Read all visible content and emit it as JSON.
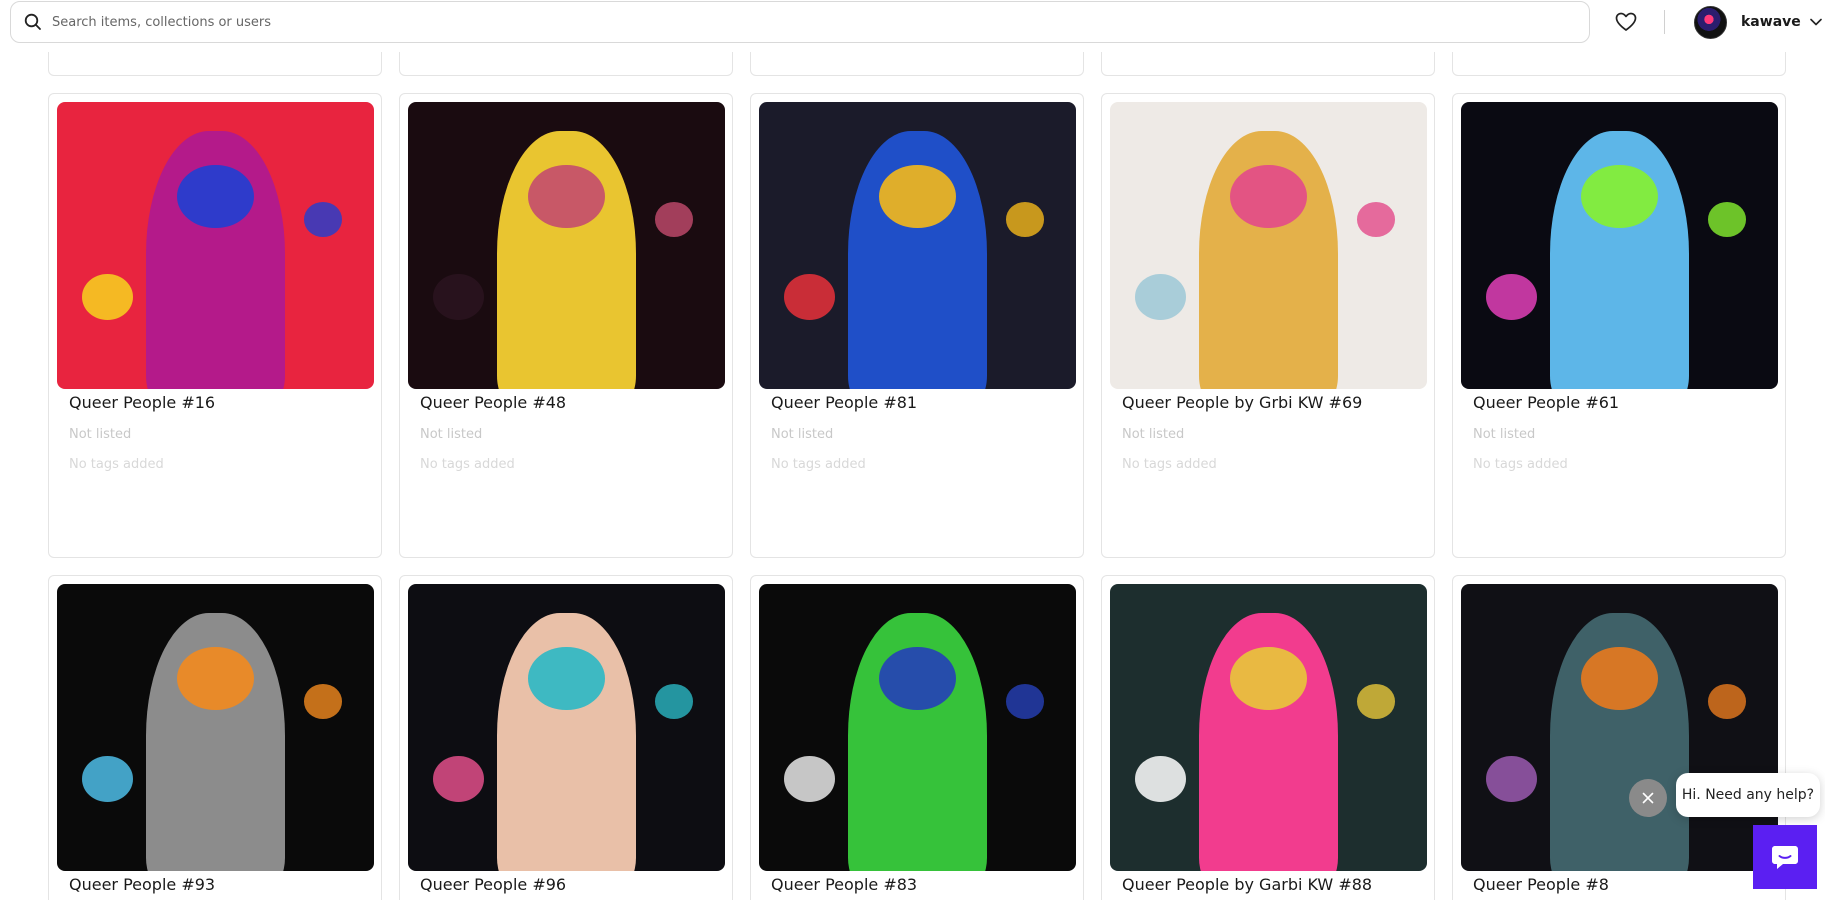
{
  "search": {
    "placeholder": "Search items, collections or users"
  },
  "user": {
    "name": "kawave"
  },
  "chat": {
    "message": "Hi. Need any help?"
  },
  "items": [
    {
      "title": "Queer People #16",
      "status": "Not listed",
      "tags": "No tags added",
      "colors": [
        "#e8243f",
        "#b41a8a",
        "#1f3fd1",
        "#f7d31e"
      ]
    },
    {
      "title": "Queer People #48",
      "status": "Not listed",
      "tags": "No tags added",
      "colors": [
        "#1a0b10",
        "#e9c530",
        "#c44b6e",
        "#2b1420"
      ]
    },
    {
      "title": "Queer People #81",
      "status": "Not listed",
      "tags": "No tags added",
      "colors": [
        "#1b1b2a",
        "#1f4fc8",
        "#f4b81a",
        "#e8303a"
      ]
    },
    {
      "title": "Queer People by Grbi KW #69",
      "status": "Not listed",
      "tags": "No tags added",
      "colors": [
        "#eeeae6",
        "#e4b14a",
        "#e24a8a",
        "#9cc8d6"
      ]
    },
    {
      "title": "Queer People #61",
      "status": "Not listed",
      "tags": "No tags added",
      "colors": [
        "#0a0a12",
        "#5db6e8",
        "#86f12f",
        "#e23fb9"
      ]
    },
    {
      "title": "Queer People #93",
      "status": "",
      "tags": "",
      "colors": [
        "#0a0a0a",
        "#8c8c8c",
        "#f28a1e",
        "#4dbde8"
      ]
    },
    {
      "title": "Queer People #96",
      "status": "",
      "tags": "",
      "colors": [
        "#0d0d12",
        "#e9c0a8",
        "#2bb8c4",
        "#e24f8a"
      ]
    },
    {
      "title": "Queer People #83",
      "status": "",
      "tags": "",
      "colors": [
        "#0a0a0a",
        "#36c23a",
        "#2540b8",
        "#e8e8e8"
      ]
    },
    {
      "title": "Queer People by Garbi KW #88",
      "status": "",
      "tags": "",
      "colors": [
        "#1d2e2e",
        "#f23c8e",
        "#e8c73a",
        "#ffffff"
      ]
    },
    {
      "title": "Queer People #8",
      "status": "",
      "tags": "",
      "colors": [
        "#101015",
        "#3f6168",
        "#e87a1e",
        "#9b5bb0"
      ]
    }
  ]
}
